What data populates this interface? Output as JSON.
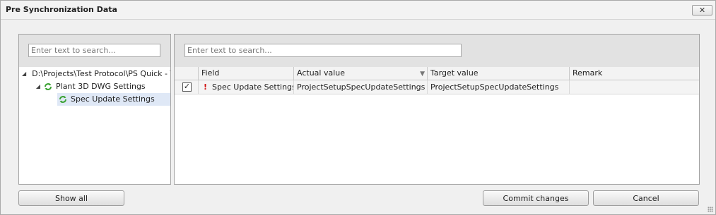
{
  "window": {
    "title": "Pre Synchronization Data",
    "close_symbol": "✕"
  },
  "left_panel": {
    "search_placeholder": "Enter text to search...",
    "tree": [
      {
        "label": "D:\\Projects\\Test Protocol\\PS Quick - T",
        "icon": "sync-icon",
        "expanded": true
      },
      {
        "label": "Plant 3D DWG Settings",
        "icon": "sync-icon",
        "expanded": true
      },
      {
        "label": "Spec Update Settings",
        "icon": "sync-icon",
        "selected": true
      }
    ]
  },
  "right_panel": {
    "search_placeholder": "Enter text to search...",
    "columns": {
      "field": "Field",
      "actual": "Actual value",
      "target": "Target value",
      "remark": "Remark"
    },
    "rows": [
      {
        "checked": true,
        "check_glyph": "✓",
        "status_glyph": "!",
        "field": "Spec Update Settings",
        "actual": "ProjectSetupSpecUpdateSettings",
        "target": "ProjectSetupSpecUpdateSettings",
        "remark": ""
      }
    ]
  },
  "buttons": {
    "show_all": "Show all",
    "commit": "Commit changes",
    "cancel": "Cancel"
  },
  "colors": {
    "selection": "#dfe8f6",
    "sync_green": "#3aa232",
    "warning_red": "#d01010"
  }
}
